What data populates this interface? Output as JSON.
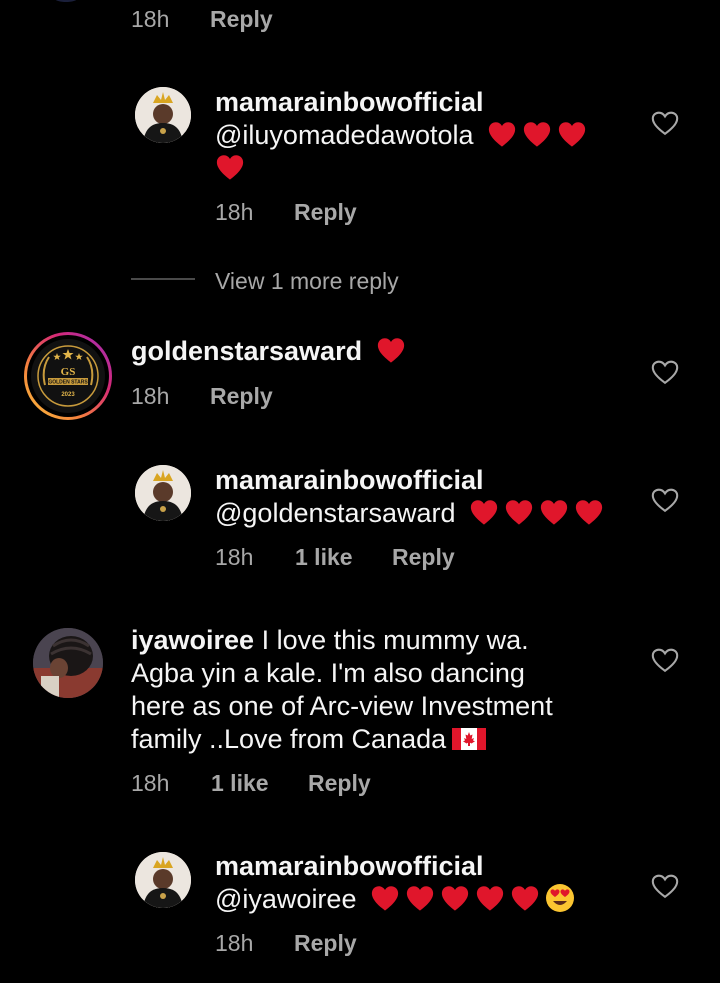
{
  "colors": {
    "background": "#000000",
    "text": "#f5f5f5",
    "secondary_text": "#a8a8a8",
    "heart": "#e0162b"
  },
  "top_partial": {
    "time": "18h",
    "reply_label": "Reply"
  },
  "comments": [
    {
      "kind": "reply",
      "username": "mamarainbowofficial",
      "mention": "@iluyomadedawotola",
      "emoji": [
        "red-heart",
        "red-heart",
        "red-heart",
        "red-heart"
      ],
      "time": "18h",
      "reply_label": "Reply",
      "avatar_icon": "profile-photo-crowned-woman"
    },
    {
      "kind": "comment",
      "username": "goldenstarsaward",
      "emoji": [
        "red-heart"
      ],
      "time": "18h",
      "reply_label": "Reply",
      "avatar_icon": "golden-stars-award-logo",
      "avatar_text": {
        "top": "GS",
        "middle": "GOLDEN STARS",
        "bottom": "2023"
      }
    },
    {
      "kind": "reply",
      "username": "mamarainbowofficial",
      "mention": "@goldenstarsaward",
      "emoji": [
        "red-heart",
        "red-heart",
        "red-heart",
        "red-heart"
      ],
      "time": "18h",
      "likes": "1 like",
      "reply_label": "Reply",
      "avatar_icon": "profile-photo-crowned-woman"
    },
    {
      "kind": "comment",
      "username": "iyawoiree",
      "text_line1": "I love this mummy  wa.",
      "text_line2": "Agba yin a kale.  I'm also dancing",
      "text_line3": "here as one of Arc-view Investment",
      "text_line4": "family ..Love from Canada",
      "emoji": [
        "canada-flag"
      ],
      "time": "18h",
      "likes": "1 like",
      "reply_label": "Reply",
      "avatar_icon": "profile-photo-braided-hair"
    },
    {
      "kind": "reply",
      "username": "mamarainbowofficial",
      "mention": "@iyawoiree",
      "emoji": [
        "red-heart",
        "red-heart",
        "red-heart",
        "red-heart",
        "red-heart",
        "heart-eyes"
      ],
      "time": "18h",
      "reply_label": "Reply",
      "avatar_icon": "profile-photo-crowned-woman"
    }
  ],
  "view_more_replies": "View 1 more reply"
}
